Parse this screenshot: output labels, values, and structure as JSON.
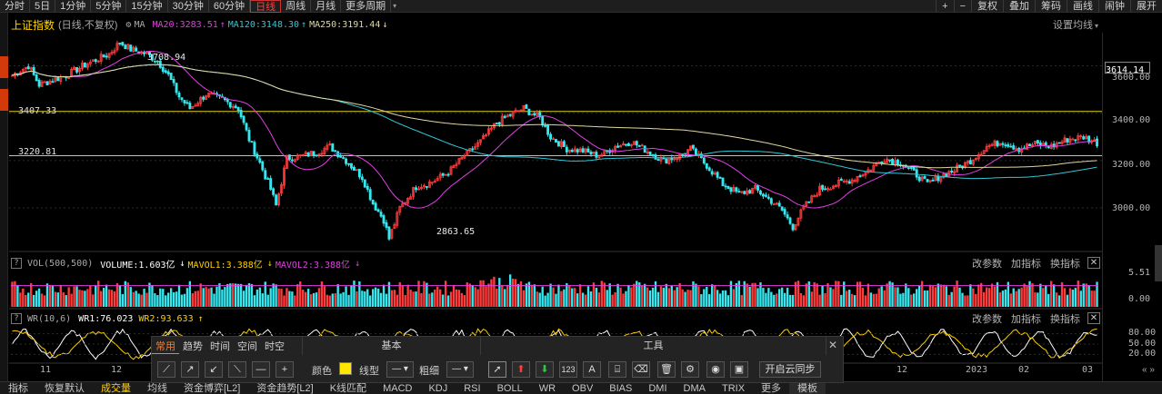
{
  "toolbar": {
    "periods": [
      "分时",
      "5日",
      "1分钟",
      "5分钟",
      "15分钟",
      "30分钟",
      "60分钟",
      "日线",
      "周线",
      "月线",
      "更多周期"
    ],
    "active_period": "日线",
    "right_buttons": [
      "+",
      "−",
      "复权",
      "叠加",
      "筹码",
      "画线",
      "闹钟",
      "展开"
    ],
    "nav_arrows": [
      "«",
      "»"
    ]
  },
  "main": {
    "index_name": "上证指数",
    "subtitle": "(日线,不复权)",
    "ma_prefix": "MA",
    "ma20": "MA20:3283.51",
    "ma120": "MA120:3148.30",
    "ma250": "MA250:3191.44",
    "set_ma_label": "设置均线",
    "price_ticks": [
      "3600.00",
      "3400.00",
      "3200.00",
      "3000.00"
    ],
    "last_price": "3614.14",
    "hline1": "3407.33",
    "hline2": "3220.81",
    "high_annot": "3708.94",
    "low_annot": "2863.65"
  },
  "volume": {
    "params": "VOL(500,500)",
    "volume": "VOLUME:1.603亿",
    "mavol1": "MAVOL1:3.388亿",
    "mavol2": "MAVOL2:3.388亿",
    "ticks": [
      "5.51",
      "0.00"
    ],
    "actions": [
      "改参数",
      "加指标",
      "换指标"
    ]
  },
  "wr": {
    "params": "WR(10,6)",
    "wr1": "WR1:76.023",
    "wr2": "WR2:93.633",
    "ticks": [
      "80.00",
      "50.00",
      "20.00"
    ],
    "actions": [
      "改参数",
      "加指标",
      "换指标"
    ]
  },
  "xaxis": [
    "11",
    "12",
    "12",
    "2023",
    "02",
    "03"
  ],
  "bottom_tabs": [
    "指标",
    "恢复默认",
    "成交量",
    "均线",
    "资金博弈[L2]",
    "资金趋势[L2]",
    "K线匹配",
    "MACD",
    "KDJ",
    "RSI",
    "BOLL",
    "WR",
    "OBV",
    "BIAS",
    "DMI",
    "DMA",
    "TRIX",
    "更多",
    "模板"
  ],
  "active_bottom_tab": "成交量",
  "draw_toolbar": {
    "tabs": [
      "常用",
      "趋势",
      "时间",
      "空间",
      "时空"
    ],
    "active_tab": "常用",
    "section_basic": "基本",
    "section_tools": "工具",
    "color_label": "颜色",
    "color_value": "#ffe600",
    "line_type_label": "线型",
    "thickness_label": "粗细",
    "num_label": "123",
    "text_label": "A",
    "cloud_sync": "开启云同步",
    "close": "✕"
  },
  "colors": {
    "up": "#ff3b3b",
    "down": "#35e8f0",
    "ma20": "#e040e0",
    "ma120": "#30c8d8",
    "ma250": "#e0d8a0",
    "hline": "#e0d020",
    "wr1": "#ffffff",
    "wr2": "#ffd000"
  },
  "chart_data": {
    "type": "candlestick",
    "title": "上证指数",
    "ylim": [
      2820,
      3740
    ],
    "highest": 3708.94,
    "lowest": 2863.65,
    "last": 3614.14,
    "horizontal_lines": [
      3407.33,
      3220.81
    ],
    "ma20_last": 3283.51,
    "ma120_last": 3148.3,
    "ma250_last": 3191.44,
    "close_path": [
      [
        0,
        3560
      ],
      [
        6,
        3600
      ],
      [
        10,
        3520
      ],
      [
        20,
        3560
      ],
      [
        28,
        3610
      ],
      [
        36,
        3650
      ],
      [
        40,
        3700
      ],
      [
        44,
        3670
      ],
      [
        50,
        3650
      ],
      [
        54,
        3620
      ],
      [
        58,
        3560
      ],
      [
        62,
        3470
      ],
      [
        66,
        3420
      ],
      [
        72,
        3480
      ],
      [
        78,
        3460
      ],
      [
        84,
        3420
      ],
      [
        88,
        3290
      ],
      [
        92,
        3190
      ],
      [
        96,
        3080
      ],
      [
        98,
        3010
      ],
      [
        102,
        3210
      ],
      [
        108,
        3220
      ],
      [
        114,
        3240
      ],
      [
        118,
        3260
      ],
      [
        124,
        3200
      ],
      [
        130,
        3130
      ],
      [
        134,
        3020
      ],
      [
        138,
        2950
      ],
      [
        140,
        2870
      ],
      [
        144,
        3000
      ],
      [
        150,
        3090
      ],
      [
        156,
        3110
      ],
      [
        162,
        3150
      ],
      [
        168,
        3220
      ],
      [
        174,
        3280
      ],
      [
        180,
        3360
      ],
      [
        186,
        3400
      ],
      [
        190,
        3420
      ],
      [
        196,
        3380
      ],
      [
        200,
        3300
      ],
      [
        206,
        3250
      ],
      [
        212,
        3240
      ],
      [
        218,
        3220
      ],
      [
        224,
        3260
      ],
      [
        230,
        3280
      ],
      [
        236,
        3240
      ],
      [
        242,
        3200
      ],
      [
        248,
        3220
      ],
      [
        252,
        3250
      ],
      [
        258,
        3180
      ],
      [
        264,
        3100
      ],
      [
        270,
        3060
      ],
      [
        276,
        3080
      ],
      [
        282,
        3030
      ],
      [
        286,
        2990
      ],
      [
        290,
        2920
      ],
      [
        294,
        3000
      ],
      [
        300,
        3080
      ],
      [
        306,
        3100
      ],
      [
        312,
        3120
      ],
      [
        318,
        3160
      ],
      [
        324,
        3210
      ],
      [
        330,
        3190
      ],
      [
        336,
        3140
      ],
      [
        340,
        3100
      ],
      [
        344,
        3130
      ],
      [
        350,
        3160
      ],
      [
        356,
        3200
      ],
      [
        362,
        3260
      ],
      [
        368,
        3280
      ],
      [
        374,
        3250
      ],
      [
        380,
        3270
      ],
      [
        386,
        3260
      ],
      [
        392,
        3290
      ],
      [
        398,
        3300
      ],
      [
        403,
        3275
      ]
    ],
    "volume_panel": {
      "ylim": [
        0,
        5.51
      ],
      "unit": "亿",
      "last": 1.603,
      "mavol1": 3.388,
      "mavol2": 3.388
    },
    "wr_panel": {
      "ylim": [
        0,
        100
      ],
      "wr1_last": 76.023,
      "wr2_last": 93.633
    }
  }
}
